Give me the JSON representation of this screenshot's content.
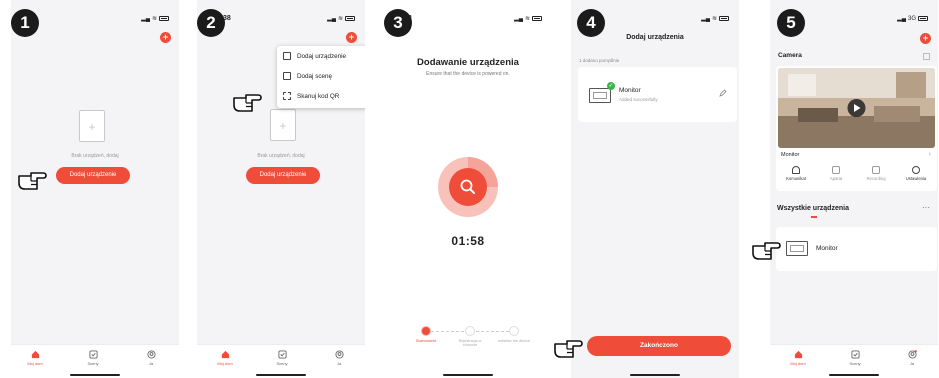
{
  "steps": [
    "1",
    "2",
    "3",
    "4",
    "5"
  ],
  "status_time": "38",
  "status_net5": "3G",
  "accent_color": "#f04c3a",
  "tabs": {
    "home": "Mój dom",
    "scenes": "Sceny",
    "me": "Ja"
  },
  "empty_text": "Brak urządzeń, dodaj",
  "add_device_button": "Dodaj urządzenie",
  "plus_symbol": "+",
  "menu": {
    "items": [
      {
        "label": "Dodaj urządzenie",
        "icon": "device-icon"
      },
      {
        "label": "Dodaj scenę",
        "icon": "scene-icon"
      },
      {
        "label": "Skanuj kod QR",
        "icon": "qr-scan-icon"
      }
    ]
  },
  "adding": {
    "title": "Dodawanie urządzenia",
    "subtitle": "Ensure that the device is powered on.",
    "timer": "01:58",
    "steps": [
      {
        "label": "Skanowanie",
        "state": "active"
      },
      {
        "label": "Rejestracja w chmurze",
        "state": "pending"
      },
      {
        "label": "Initialize the device",
        "state": "pending"
      }
    ]
  },
  "added": {
    "title": "Dodaj urządzenia",
    "section": "1 dodano pomyślnie",
    "device_name": "Monitor",
    "device_status": "Added successfully",
    "finish_button": "Zakończono"
  },
  "home": {
    "section_title": "Camera",
    "camera_name": "Monitor",
    "quick_actions": [
      "Komunikat",
      "Aparat",
      "Recording",
      "Ustawienia"
    ],
    "all_devices_title": "Wszystkie urządzenia",
    "device_name": "Monitor",
    "more": "···"
  }
}
